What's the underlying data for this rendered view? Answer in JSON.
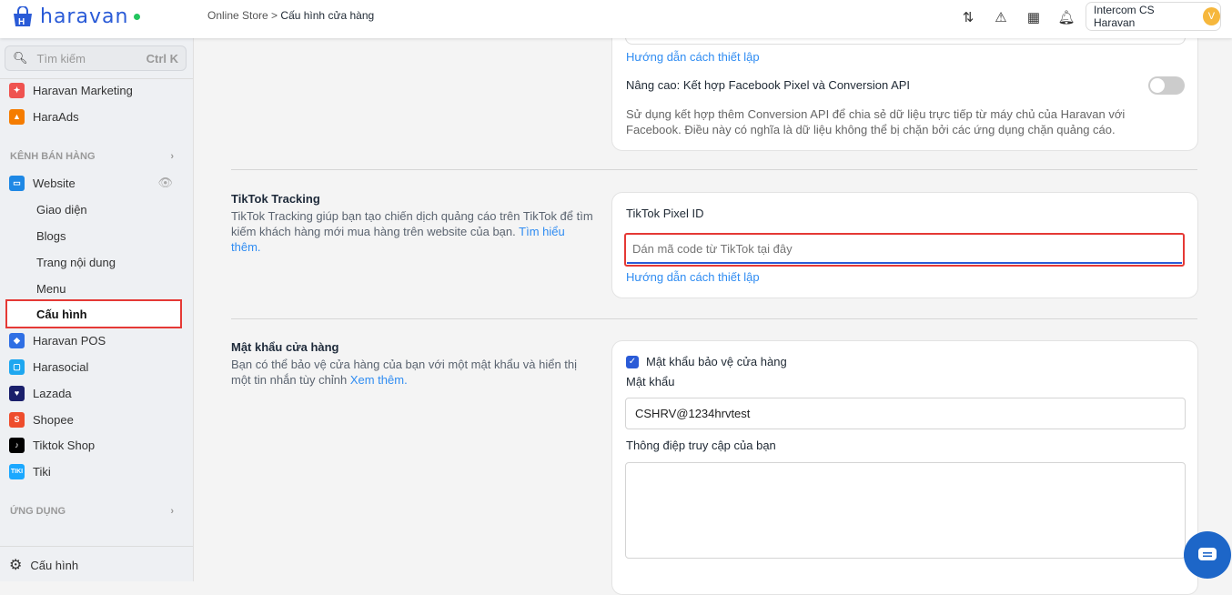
{
  "header": {
    "logo": "haravan",
    "breadcrumb_parent": "Online Store",
    "breadcrumb_sep": ">",
    "breadcrumb_current": "Cấu hình cửa hàng",
    "user_name": "Intercom CS Haravan",
    "avatar_letter": "V"
  },
  "sidebar": {
    "search_placeholder": "Tìm kiếm",
    "search_shortcut": "Ctrl K",
    "apps_top": [
      {
        "label": "Haravan Marketing"
      },
      {
        "label": "HaraAds"
      }
    ],
    "section_sales": "KÊNH BÁN HÀNG",
    "website": "Website",
    "website_sub": [
      {
        "label": "Giao diện"
      },
      {
        "label": "Blogs"
      },
      {
        "label": "Trang nội dung"
      },
      {
        "label": "Menu"
      },
      {
        "label": "Cấu hình"
      }
    ],
    "channels": [
      {
        "label": "Haravan POS"
      },
      {
        "label": "Harasocial"
      },
      {
        "label": "Lazada"
      },
      {
        "label": "Shopee"
      },
      {
        "label": "Tiktok Shop"
      },
      {
        "label": "Tiki"
      }
    ],
    "section_apps": "ỨNG DỤNG",
    "settings": "Cấu hình"
  },
  "facebook": {
    "guide_link": "Hướng dẫn cách thiết lập",
    "advanced_label": "Nâng cao: Kết hợp Facebook Pixel và Conversion API",
    "advanced_enabled": false,
    "advanced_desc": "Sử dụng kết hợp thêm Conversion API để chia sẻ dữ liệu trực tiếp từ máy chủ của Haravan với Facebook. Điều này có nghĩa là dữ liệu không thể bị chặn bởi các ứng dụng chặn quảng cáo."
  },
  "tiktok": {
    "title": "TikTok Tracking",
    "desc": "TikTok Tracking giúp bạn tạo chiến dịch quảng cáo trên TikTok để tìm kiếm khách hàng mới mua hàng trên website của bạn.",
    "learn_more": "Tìm hiểu thêm.",
    "pixel_label": "TikTok Pixel ID",
    "pixel_value": "",
    "pixel_placeholder": "Dán mã code từ TikTok tại đây",
    "guide_link": "Hướng dẫn cách thiết lập"
  },
  "password": {
    "title": "Mật khẩu cửa hàng",
    "desc": "Bạn có thể bảo vệ cửa hàng của bạn với một mật khẩu và hiển thị một tin nhắn tùy chỉnh",
    "see_more": "Xem thêm.",
    "protect_label": "Mật khẩu bảo vệ cửa hàng",
    "protect_checked": true,
    "password_label": "Mật khẩu",
    "password_value": "CSHRV@1234hrvtest",
    "message_label": "Thông điệp truy cập của bạn",
    "message_value": ""
  },
  "colors": {
    "brand": "#2a5bd7",
    "link": "#2f8cf2",
    "highlight": "#e53935"
  }
}
